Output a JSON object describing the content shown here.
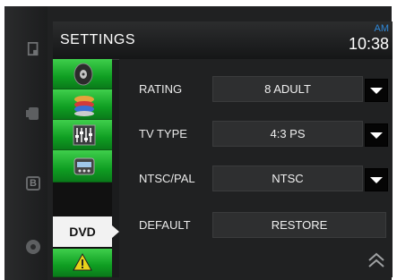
{
  "header": {
    "title": "SETTINGS",
    "ampm": "AM",
    "time": "10:38"
  },
  "sidebar": {
    "items": [
      {
        "name": "audio",
        "icon": "speaker-icon"
      },
      {
        "name": "general",
        "icon": "layers-icon"
      },
      {
        "name": "equalizer",
        "icon": "equalizer-icon"
      },
      {
        "name": "radio",
        "icon": "radio-icon"
      },
      {
        "name": "dvd",
        "label": "DVD",
        "selected": true
      },
      {
        "name": "warning",
        "icon": "warning-icon"
      }
    ]
  },
  "settings": {
    "rating": {
      "label": "RATING",
      "value": "8 ADULT"
    },
    "tv_type": {
      "label": "TV TYPE",
      "value": "4:3 PS"
    },
    "ntsc_pal": {
      "label": "NTSC/PAL",
      "value": "NTSC"
    },
    "default": {
      "label": "DEFAULT",
      "value": "RESTORE"
    }
  },
  "colors": {
    "accent_green": "#17ab2c",
    "clock_ampm": "#2f88d8"
  }
}
